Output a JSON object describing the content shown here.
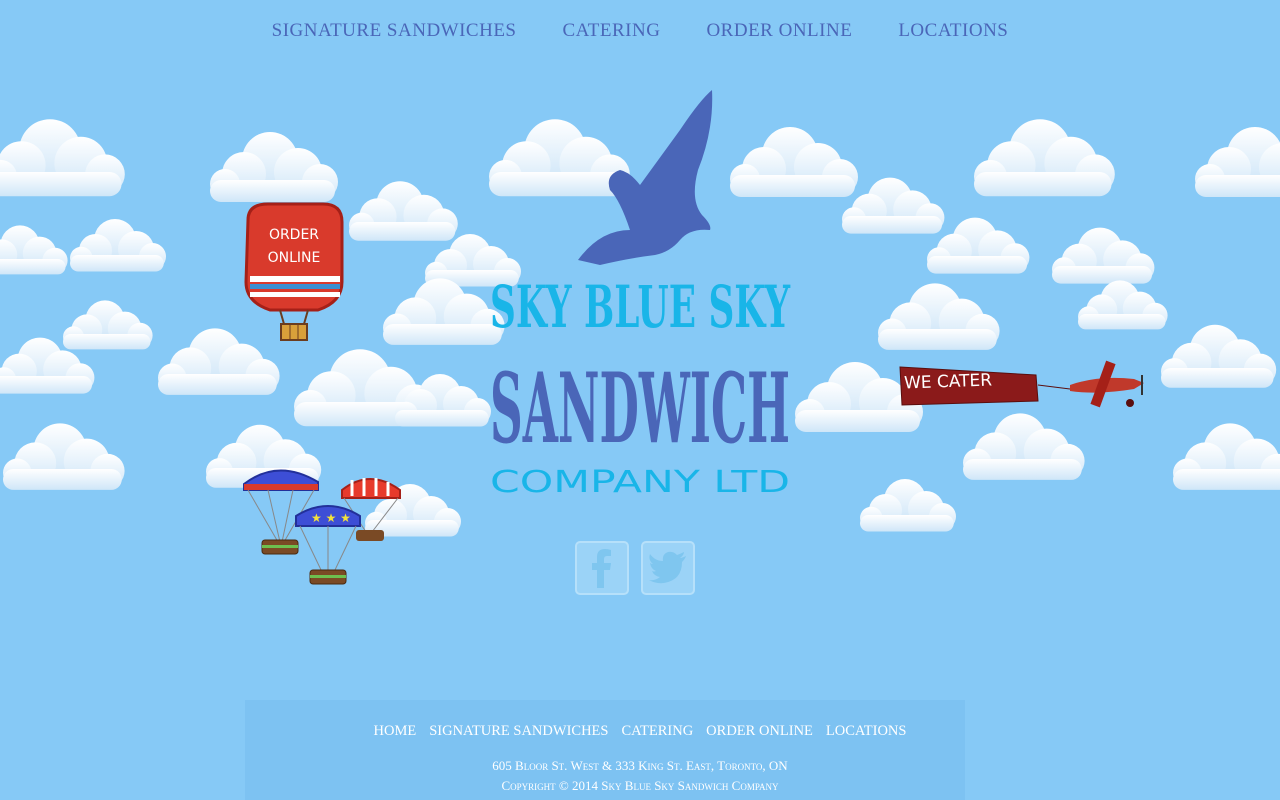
{
  "nav": {
    "items": [
      "SIGNATURE SANDWICHES",
      "CATERING",
      "ORDER ONLINE",
      "LOCATIONS"
    ]
  },
  "logo": {
    "line1": "SKY BLUE SKY",
    "line2": "SANDWICH",
    "line3": "COMPANY LTD"
  },
  "balloon": {
    "text_line1": "ORDER",
    "text_line2": "ONLINE"
  },
  "banner": {
    "text": "WE CATER"
  },
  "social": [
    {
      "icon": "facebook-icon"
    },
    {
      "icon": "twitter-icon"
    }
  ],
  "footer": {
    "nav": [
      "HOME",
      "SIGNATURE SANDWICHES",
      "CATERING",
      "ORDER ONLINE",
      "LOCATIONS"
    ],
    "address": "605 Bloor St. West & 333 King St. East, Toronto, ON",
    "copyright": "Copyright © 2014 Sky Blue Sky Sandwich Company"
  },
  "colors": {
    "sky": "#86c9f6",
    "nav_text": "#4a66b8",
    "logo_cyan": "#19b5e8",
    "logo_blue": "#4a66b8",
    "balloon_red": "#d93a2c",
    "banner_red": "#8b1a1a"
  }
}
